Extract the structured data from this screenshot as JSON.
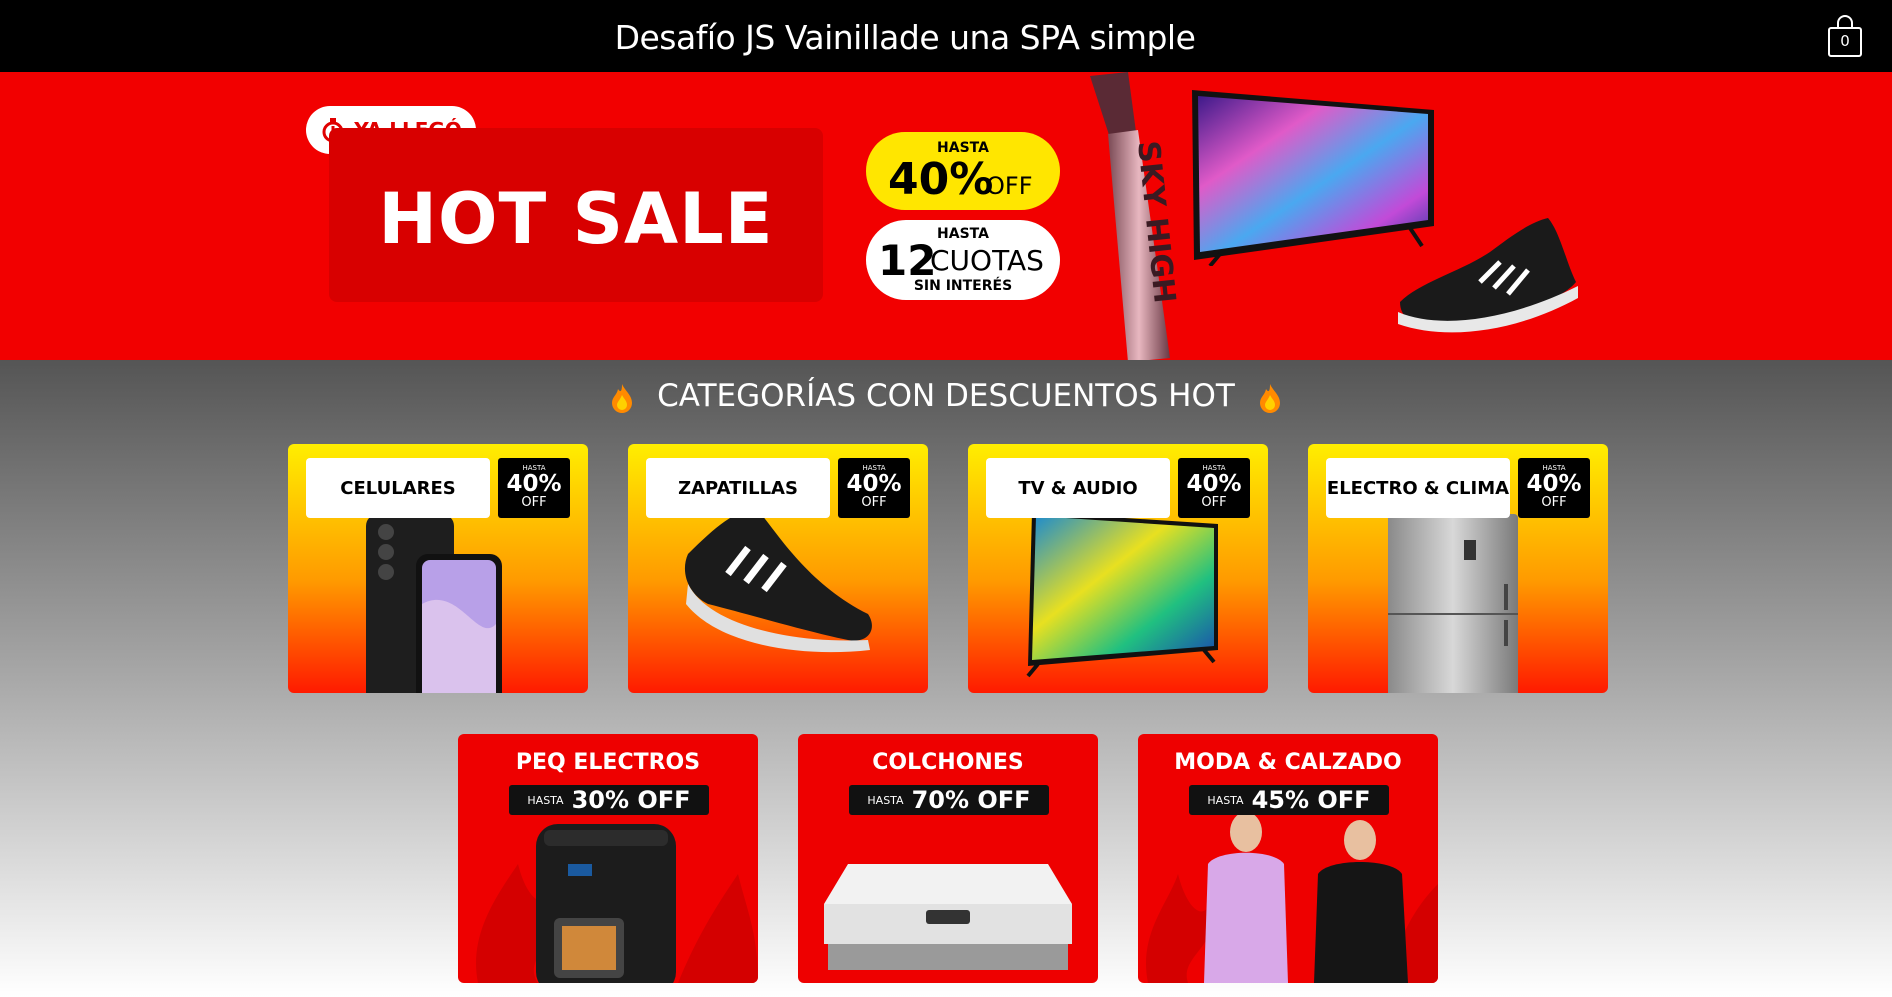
{
  "header": {
    "title": "Desafío JS Vainillade una SPA simple",
    "cart_count": "0"
  },
  "banner": {
    "pill_label": "YA LLEGÓ",
    "headline": "HOT SALE",
    "discount": {
      "small": "HASTA",
      "value": "40%",
      "suffix": "OFF"
    },
    "installments": {
      "small": "HASTA",
      "value": "12",
      "suffix": "CUOTAS",
      "footer": "SIN INTERÉS"
    },
    "product_text": "SKY HIGH"
  },
  "section": {
    "heading": "CATEGORÍAS CON DESCUENTOS HOT"
  },
  "categories_top": [
    {
      "label": "CELULARES",
      "off_small": "HASTA",
      "off_value": "40%",
      "off_suffix": "OFF"
    },
    {
      "label": "ZAPATILLAS",
      "off_small": "HASTA",
      "off_value": "40%",
      "off_suffix": "OFF"
    },
    {
      "label": "TV & AUDIO",
      "off_small": "HASTA",
      "off_value": "40%",
      "off_suffix": "OFF"
    },
    {
      "label": "ELECTRO & CLIMA",
      "off_small": "HASTA",
      "off_value": "40%",
      "off_suffix": "OFF"
    }
  ],
  "categories_bottom": [
    {
      "label": "PEQ ELECTROS",
      "off_small": "HASTA",
      "off_value": "30% OFF"
    },
    {
      "label": "COLCHONES",
      "off_small": "HASTA",
      "off_value": "70% OFF"
    },
    {
      "label": "MODA & CALZADO",
      "off_small": "HASTA",
      "off_value": "45% OFF"
    }
  ],
  "colors": {
    "topbar": "#000000",
    "banner_red": "#f20000",
    "yellow": "#ffe600",
    "card_red": "#ee0000"
  }
}
